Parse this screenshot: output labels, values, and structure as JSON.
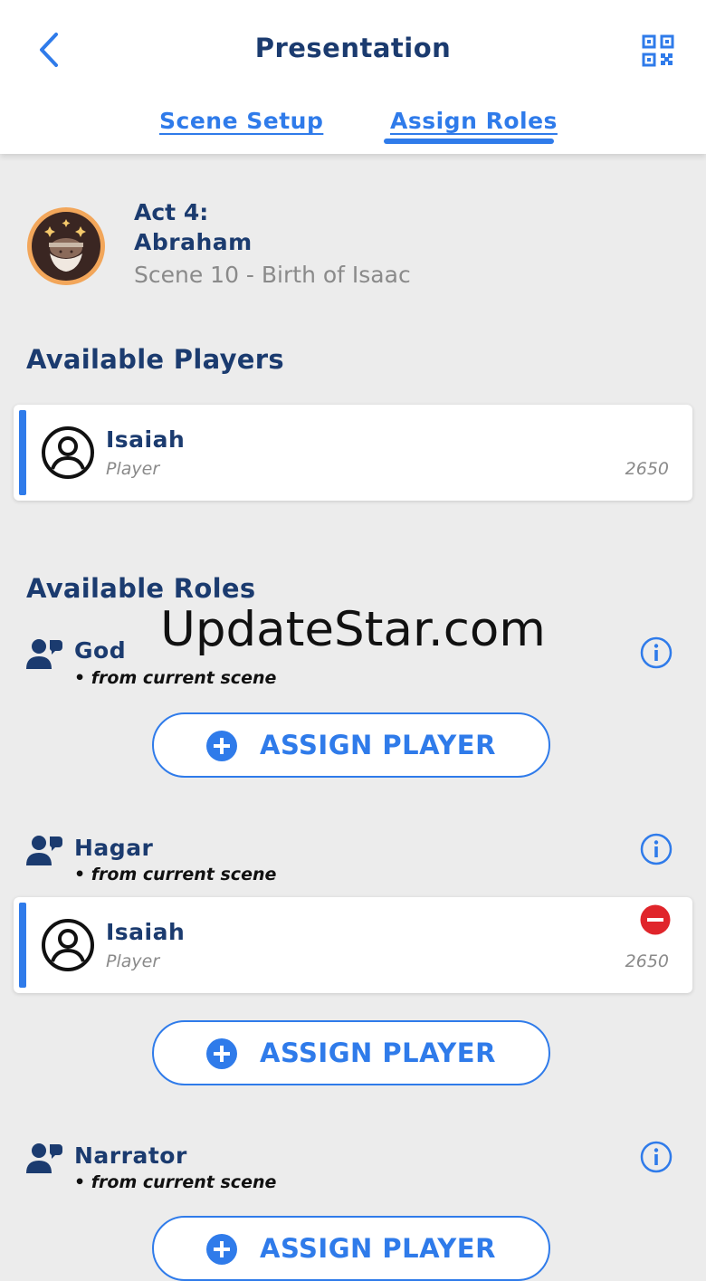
{
  "header": {
    "title": "Presentation",
    "tabs": [
      {
        "label": "Scene Setup",
        "active": false
      },
      {
        "label": "Assign Roles",
        "active": true
      }
    ],
    "accent_color": "#2f7bea"
  },
  "scene": {
    "act_label": "Act 4:",
    "act_name": "Abraham",
    "scene_name": "Scene 10 - Birth of Isaac"
  },
  "available_players": {
    "title": "Available Players",
    "players": [
      {
        "name": "Isaiah",
        "type": "Player",
        "score": "2650"
      }
    ]
  },
  "available_roles": {
    "title": "Available Roles",
    "roles": [
      {
        "name": "God",
        "source": "• from current scene",
        "assigned": [],
        "button_label": "ASSIGN PLAYER"
      },
      {
        "name": "Hagar",
        "source": "• from current scene",
        "assigned": [
          {
            "name": "Isaiah",
            "type": "Player",
            "score": "2650"
          }
        ],
        "button_label": "ASSIGN PLAYER"
      },
      {
        "name": "Narrator",
        "source": "• from current scene",
        "assigned": [],
        "button_label": "ASSIGN PLAYER"
      }
    ]
  },
  "watermark": "UpdateStar.com",
  "colors": {
    "primary_text": "#1b3b6f",
    "accent": "#2f7bea",
    "remove": "#e0252b",
    "background": "#ececec"
  }
}
